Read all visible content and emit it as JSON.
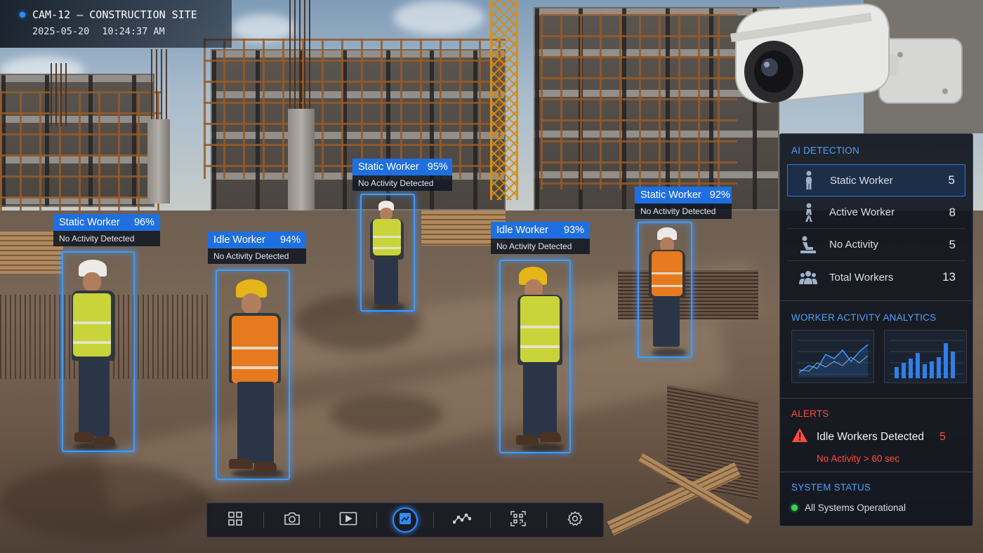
{
  "header": {
    "camera_title": "CAM-12 – CONSTRUCTION SITE",
    "date": "2025-05-20",
    "time": "10:24:37 AM"
  },
  "detections": [
    {
      "label": "Static Worker",
      "confidence": "96%",
      "status": "No Activity Detected"
    },
    {
      "label": "Idle Worker",
      "confidence": "94%",
      "status": "No Activity Detected"
    },
    {
      "label": "Static Worker",
      "confidence": "95%",
      "status": "No Activity Detected"
    },
    {
      "label": "Idle Worker",
      "confidence": "93%",
      "status": "No Activity Detected"
    },
    {
      "label": "Static Worker",
      "confidence": "92%",
      "status": "No Activity Detected"
    }
  ],
  "panel": {
    "ai_detection": {
      "title": "AI DETECTION",
      "rows": [
        {
          "icon": "standing-person-icon",
          "label": "Static Worker",
          "count": "5"
        },
        {
          "icon": "walking-person-icon",
          "label": "Active Worker",
          "count": "8"
        },
        {
          "icon": "sitting-person-icon",
          "label": "No Activity",
          "count": "5"
        },
        {
          "icon": "group-icon",
          "label": "Total Workers",
          "count": "13"
        }
      ]
    },
    "analytics": {
      "title": "WORKER ACTIVITY ANALYTICS"
    },
    "alerts": {
      "title": "ALERTS",
      "alert_label": "Idle Workers Detected",
      "alert_count": "5",
      "alert_detail": "No Activity > 60 sec"
    },
    "system": {
      "title": "SYSTEM STATUS",
      "status": "All Systems Operational"
    }
  },
  "toolbar": {
    "tools": [
      "grid-icon",
      "camera-icon",
      "play-icon",
      "detection-icon",
      "analytics-icon",
      "qr-scan-icon",
      "settings-icon"
    ],
    "active_tool": "detection-icon"
  },
  "colors": {
    "accent": "#2f8cff",
    "alert": "#ff4b3e",
    "ok": "#3ccf5a",
    "panel_bg": "#10151e"
  }
}
